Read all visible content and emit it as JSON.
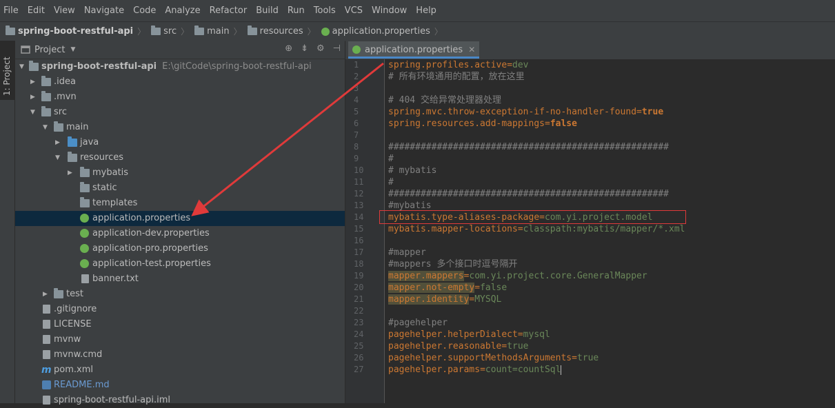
{
  "menu": [
    "File",
    "Edit",
    "View",
    "Navigate",
    "Code",
    "Analyze",
    "Refactor",
    "Build",
    "Run",
    "Tools",
    "VCS",
    "Window",
    "Help"
  ],
  "breadcrumb": [
    "spring-boot-restful-api",
    "src",
    "main",
    "resources",
    "application.properties"
  ],
  "side_tab": "1: Project",
  "panel": {
    "title": "Project"
  },
  "tree": [
    {
      "label": "spring-boot-restful-api",
      "note": "E:\\gitCode\\spring-boot-restful-api"
    },
    {
      "label": ".idea"
    },
    {
      "label": ".mvn"
    },
    {
      "label": "src"
    },
    {
      "label": "main"
    },
    {
      "label": "java"
    },
    {
      "label": "resources"
    },
    {
      "label": "mybatis"
    },
    {
      "label": "static"
    },
    {
      "label": "templates"
    },
    {
      "label": "application.properties"
    },
    {
      "label": "application-dev.properties"
    },
    {
      "label": "application-pro.properties"
    },
    {
      "label": "application-test.properties"
    },
    {
      "label": "banner.txt"
    },
    {
      "label": "test"
    },
    {
      "label": ".gitignore"
    },
    {
      "label": "LICENSE"
    },
    {
      "label": "mvnw"
    },
    {
      "label": "mvnw.cmd"
    },
    {
      "label": "pom.xml"
    },
    {
      "label": "README.md"
    },
    {
      "label": "spring-boot-restful-api.iml"
    }
  ],
  "editor_tab": "application.properties",
  "code_lines": [
    [
      {
        "t": "spring.profiles.active",
        "c": "k"
      },
      {
        "t": "=",
        "c": "k"
      },
      {
        "t": "dev",
        "c": "v"
      }
    ],
    [
      {
        "t": "# 所有环境通用的配置，放在这里",
        "c": "c"
      }
    ],
    [],
    [
      {
        "t": "# 404 交给异常处理器处理",
        "c": "c"
      }
    ],
    [
      {
        "t": "spring.mvc.throw-exception-if-no-handler-found",
        "c": "k"
      },
      {
        "t": "=",
        "c": "k"
      },
      {
        "t": "true",
        "c": "bk"
      }
    ],
    [
      {
        "t": "spring.resources.add-mappings",
        "c": "k"
      },
      {
        "t": "=",
        "c": "k"
      },
      {
        "t": "false",
        "c": "bk"
      }
    ],
    [],
    [
      {
        "t": "####################################################",
        "c": "c"
      }
    ],
    [
      {
        "t": "#",
        "c": "c"
      }
    ],
    [
      {
        "t": "# mybatis",
        "c": "c"
      }
    ],
    [
      {
        "t": "#",
        "c": "c"
      }
    ],
    [
      {
        "t": "####################################################",
        "c": "c"
      }
    ],
    [
      {
        "t": "#mybatis",
        "c": "c"
      }
    ],
    [
      {
        "t": "mybatis.type-aliases-package",
        "c": "k"
      },
      {
        "t": "=",
        "c": "k"
      },
      {
        "t": "com.yi.project.model",
        "c": "v"
      }
    ],
    [
      {
        "t": "mybatis.mapper-locations",
        "c": "k"
      },
      {
        "t": "=",
        "c": "k"
      },
      {
        "t": "classpath:mybatis/mapper/*.xml",
        "c": "v"
      }
    ],
    [],
    [
      {
        "t": "#mapper",
        "c": "c"
      }
    ],
    [
      {
        "t": "#mappers 多个接口时逗号隔开",
        "c": "c"
      }
    ],
    [
      {
        "t": "mapper.mappers",
        "c": "k hl"
      },
      {
        "t": "=",
        "c": "k"
      },
      {
        "t": "com.yi.project.core.GeneralMapper",
        "c": "v"
      }
    ],
    [
      {
        "t": "mapper.not-empty",
        "c": "k hl"
      },
      {
        "t": "=",
        "c": "k"
      },
      {
        "t": "false",
        "c": "v"
      }
    ],
    [
      {
        "t": "mapper.identity",
        "c": "k hl"
      },
      {
        "t": "=",
        "c": "k"
      },
      {
        "t": "MYSQL",
        "c": "v"
      }
    ],
    [],
    [
      {
        "t": "#pagehelper",
        "c": "c"
      }
    ],
    [
      {
        "t": "pagehelper.helperDialect",
        "c": "k"
      },
      {
        "t": "=",
        "c": "k"
      },
      {
        "t": "mysql",
        "c": "v"
      }
    ],
    [
      {
        "t": "pagehelper.reasonable",
        "c": "k"
      },
      {
        "t": "=",
        "c": "k"
      },
      {
        "t": "true",
        "c": "v"
      }
    ],
    [
      {
        "t": "pagehelper.supportMethodsArguments",
        "c": "k"
      },
      {
        "t": "=",
        "c": "k"
      },
      {
        "t": "true",
        "c": "v"
      }
    ],
    [
      {
        "t": "pagehelper.params",
        "c": "k"
      },
      {
        "t": "=",
        "c": "k"
      },
      {
        "t": "count=countSql",
        "c": "v"
      }
    ]
  ],
  "colors": {
    "key": "#cc7832",
    "value": "#6a8759",
    "comment": "#808080",
    "selection": "#0d293e",
    "annotation": "#e03a3a"
  }
}
